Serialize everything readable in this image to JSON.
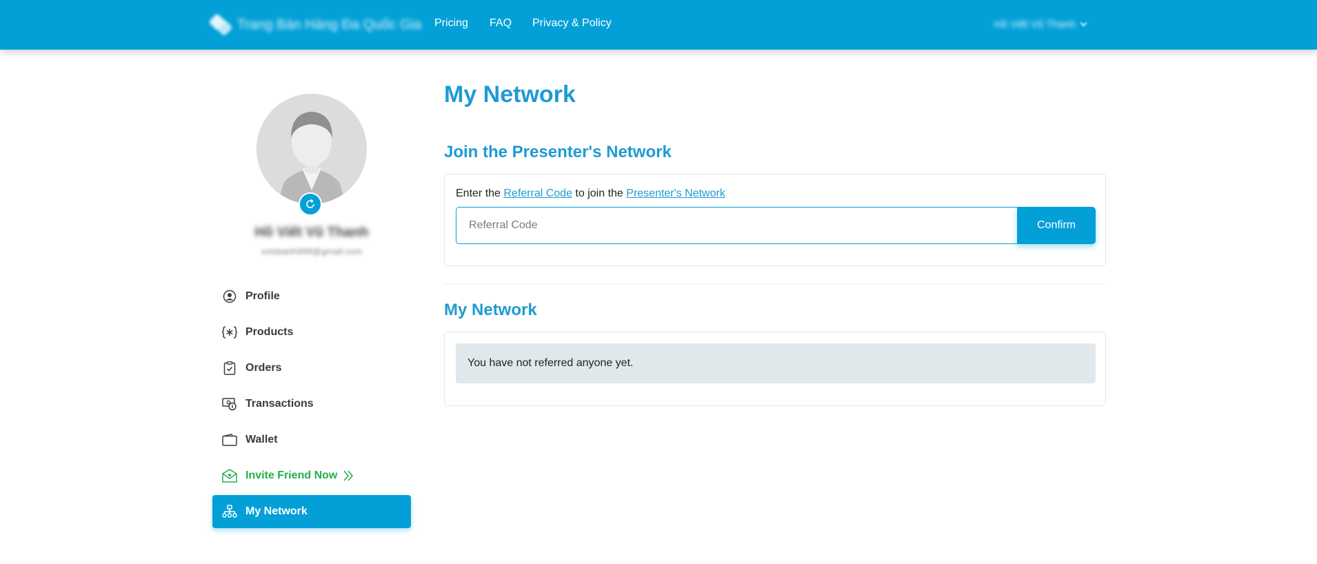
{
  "header": {
    "brand_name": "Trang Bán Hàng Đa Quốc Gia",
    "nav": [
      {
        "label": "Pricing"
      },
      {
        "label": "FAQ"
      },
      {
        "label": "Privacy & Policy"
      }
    ],
    "user_name": "Hồ Viết Vũ Thanh"
  },
  "profile": {
    "name": "Hồ Viết Vũ Thanh",
    "email": "vvtsbanh999@gmail.com"
  },
  "sidebar": {
    "items": [
      {
        "label": "Profile",
        "icon": "user-circle-icon"
      },
      {
        "label": "Products",
        "icon": "products-braces-icon"
      },
      {
        "label": "Orders",
        "icon": "clipboard-check-icon"
      },
      {
        "label": "Transactions",
        "icon": "transactions-icon"
      },
      {
        "label": "Wallet",
        "icon": "wallet-icon"
      },
      {
        "label": "Invite Friend Now",
        "icon": "invite-envelope-icon"
      },
      {
        "label": "My Network",
        "icon": "network-icon"
      }
    ],
    "active": "My Network"
  },
  "main": {
    "title": "My Network",
    "join_section": {
      "title": "Join the Presenter's Network",
      "text_before": "Enter the ",
      "link_referral": "Referral Code",
      "text_middle": " to join the ",
      "link_network": "Presenter's Network",
      "input_placeholder": "Referral Code",
      "input_value": "",
      "confirm_label": "Confirm"
    },
    "network_section": {
      "title": "My Network",
      "empty_message": "You have not referred anyone yet."
    }
  },
  "colors": {
    "primary": "#03a0d8",
    "heading": "#1e9bd2",
    "invite": "#20b04b",
    "alert_bg": "#e1e8eb"
  }
}
